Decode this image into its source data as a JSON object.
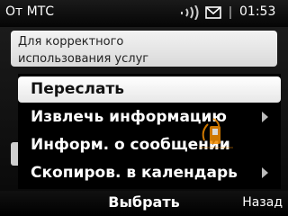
{
  "status_bar": {
    "sender": "От МТС",
    "time": "01:53",
    "icons": [
      "signal-icon",
      "envelope-icon"
    ]
  },
  "message": {
    "lines": [
      "Для корректного",
      "использования услуг"
    ]
  },
  "menu": {
    "items": [
      {
        "label": "Переслать",
        "selected": true,
        "submenu": false
      },
      {
        "label": "Извлечь информацию",
        "selected": false,
        "submenu": true
      },
      {
        "label": "Информ. о сообщении",
        "selected": false,
        "submenu": false
      },
      {
        "label": "Скопиров. в календарь",
        "selected": false,
        "submenu": true
      }
    ]
  },
  "softkeys": {
    "select": "Выбрать",
    "back": "Назад"
  },
  "colors": {
    "background": "#000000",
    "highlight": "#ffffff",
    "message_bg": "#e8e8e8",
    "watermark": "#f28c00"
  }
}
